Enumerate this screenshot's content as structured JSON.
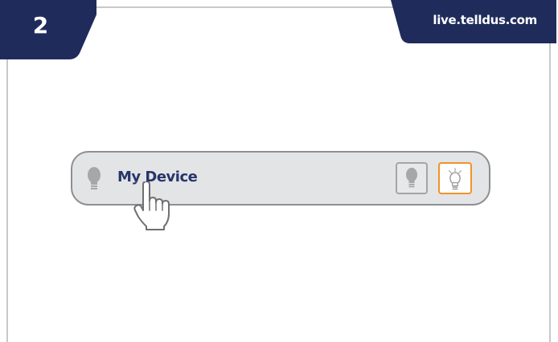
{
  "step": {
    "number": "2"
  },
  "header": {
    "url": "live.telldus.com"
  },
  "device": {
    "name": "My Device",
    "state": "off"
  },
  "colors": {
    "navy": "#1f2c5b",
    "device_name": "#27356a",
    "row_background": "#e3e4e6",
    "on_accent": "#f0932b",
    "bulb_gray": "#a7a7a7"
  },
  "icons": {
    "row": "bulb-off-icon",
    "off_button": "bulb-off-icon",
    "on_button": "bulb-on-icon",
    "cursor": "hand-pointer-icon"
  }
}
